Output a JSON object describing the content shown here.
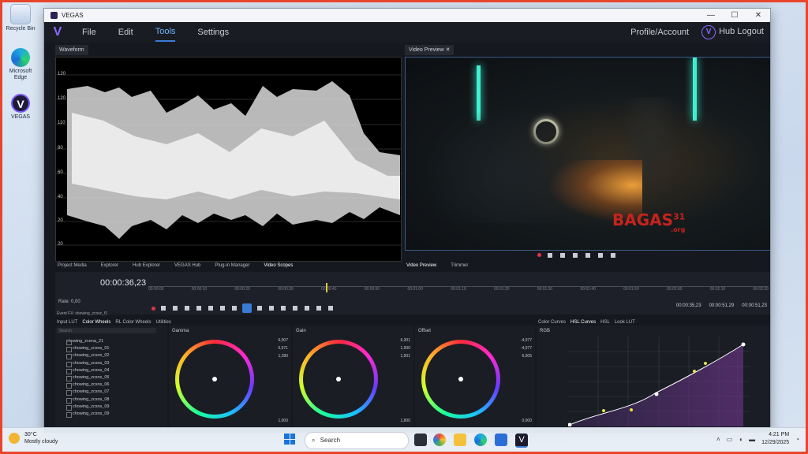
{
  "desktop": {
    "icons": [
      {
        "label": "Recycle Bin"
      },
      {
        "label": "Microsoft Edge"
      },
      {
        "label": "VEGAS"
      }
    ]
  },
  "window": {
    "title": "VEGAS",
    "controls": {
      "minimize": "—",
      "maximize": "☐",
      "close": "✕"
    }
  },
  "menu": {
    "logo": "V",
    "items": [
      "File",
      "Edit",
      "Tools",
      "Settings"
    ],
    "active": "Tools",
    "profile": "Profile/Account",
    "hub_logout": "Hub Logout"
  },
  "waveform": {
    "tab": "Waveform",
    "scale": [
      "120",
      "120",
      "110",
      "80",
      "60",
      "40",
      "20",
      "0",
      "20"
    ]
  },
  "preview": {
    "tab": "Video Preview",
    "watermark": "BAGAS",
    "watermark_num": "31",
    "watermark_org": ".org"
  },
  "dock_tabs_left": [
    "Project Media",
    "Explorer",
    "Hub Explorer",
    "VEGAS Hub",
    "Plug-in Manager",
    "Video Scopes"
  ],
  "dock_tabs_right": [
    "Video Preview",
    "Trimmer"
  ],
  "timeline": {
    "timecode": "00:00:36,23",
    "rate": "Rate: 0,00",
    "ruler": [
      "00:00:00",
      "00:00:10",
      "00:00:20",
      "00:00:30",
      "00:00:40",
      "00:00:50",
      "00:01:00",
      "00:01:10",
      "00:01:20",
      "00:01:30",
      "00:01:40",
      "00:01:50",
      "00:02:00",
      "00:02:10",
      "00:02:20"
    ],
    "time_in": "00:00:35,23",
    "time_out": "00:00:51,29",
    "time_len": "00:00:51,23"
  },
  "grading": {
    "left_tabs": [
      "Input LUT",
      "Color Wheels",
      "RL Color Wheels",
      "Utilities"
    ],
    "breadcrumb": "Event FX: showing_zcosc_f1",
    "search_placeholder": "Search",
    "folder": "chowing_zcena_21",
    "files": [
      "chowing_zcsns_01",
      "chowing_zcsns_02",
      "chowing_zcsns_03",
      "chowing_zcsns_04",
      "chowing_zcsns_05",
      "chowing_zcsns_06",
      "chowing_zcsns_07",
      "chowing_zcsns_08",
      "chowing_zcsns_09",
      "chowing_zcsns_09"
    ],
    "wheels": [
      {
        "name": "Gamma",
        "r": "6,007",
        "g": "5,071",
        "b": "1,280",
        "y": "1,000"
      },
      {
        "name": "Gain",
        "r": "6,301",
        "g": "1,900",
        "b": "1,501",
        "y": "1,800"
      },
      {
        "name": "Offset",
        "r": "-4,077",
        "g": "-4,077",
        "b": "6,005",
        "y": "0,000"
      }
    ],
    "right_tabs": [
      "Color Curves",
      "HSL Curves",
      "HSL",
      "Look LUT"
    ],
    "curve_label": "RGB"
  },
  "taskbar": {
    "temp": "30°C",
    "weather": "Mostly cloudy",
    "search": "Search",
    "time": "4:21 PM",
    "date": "12/29/2025"
  }
}
